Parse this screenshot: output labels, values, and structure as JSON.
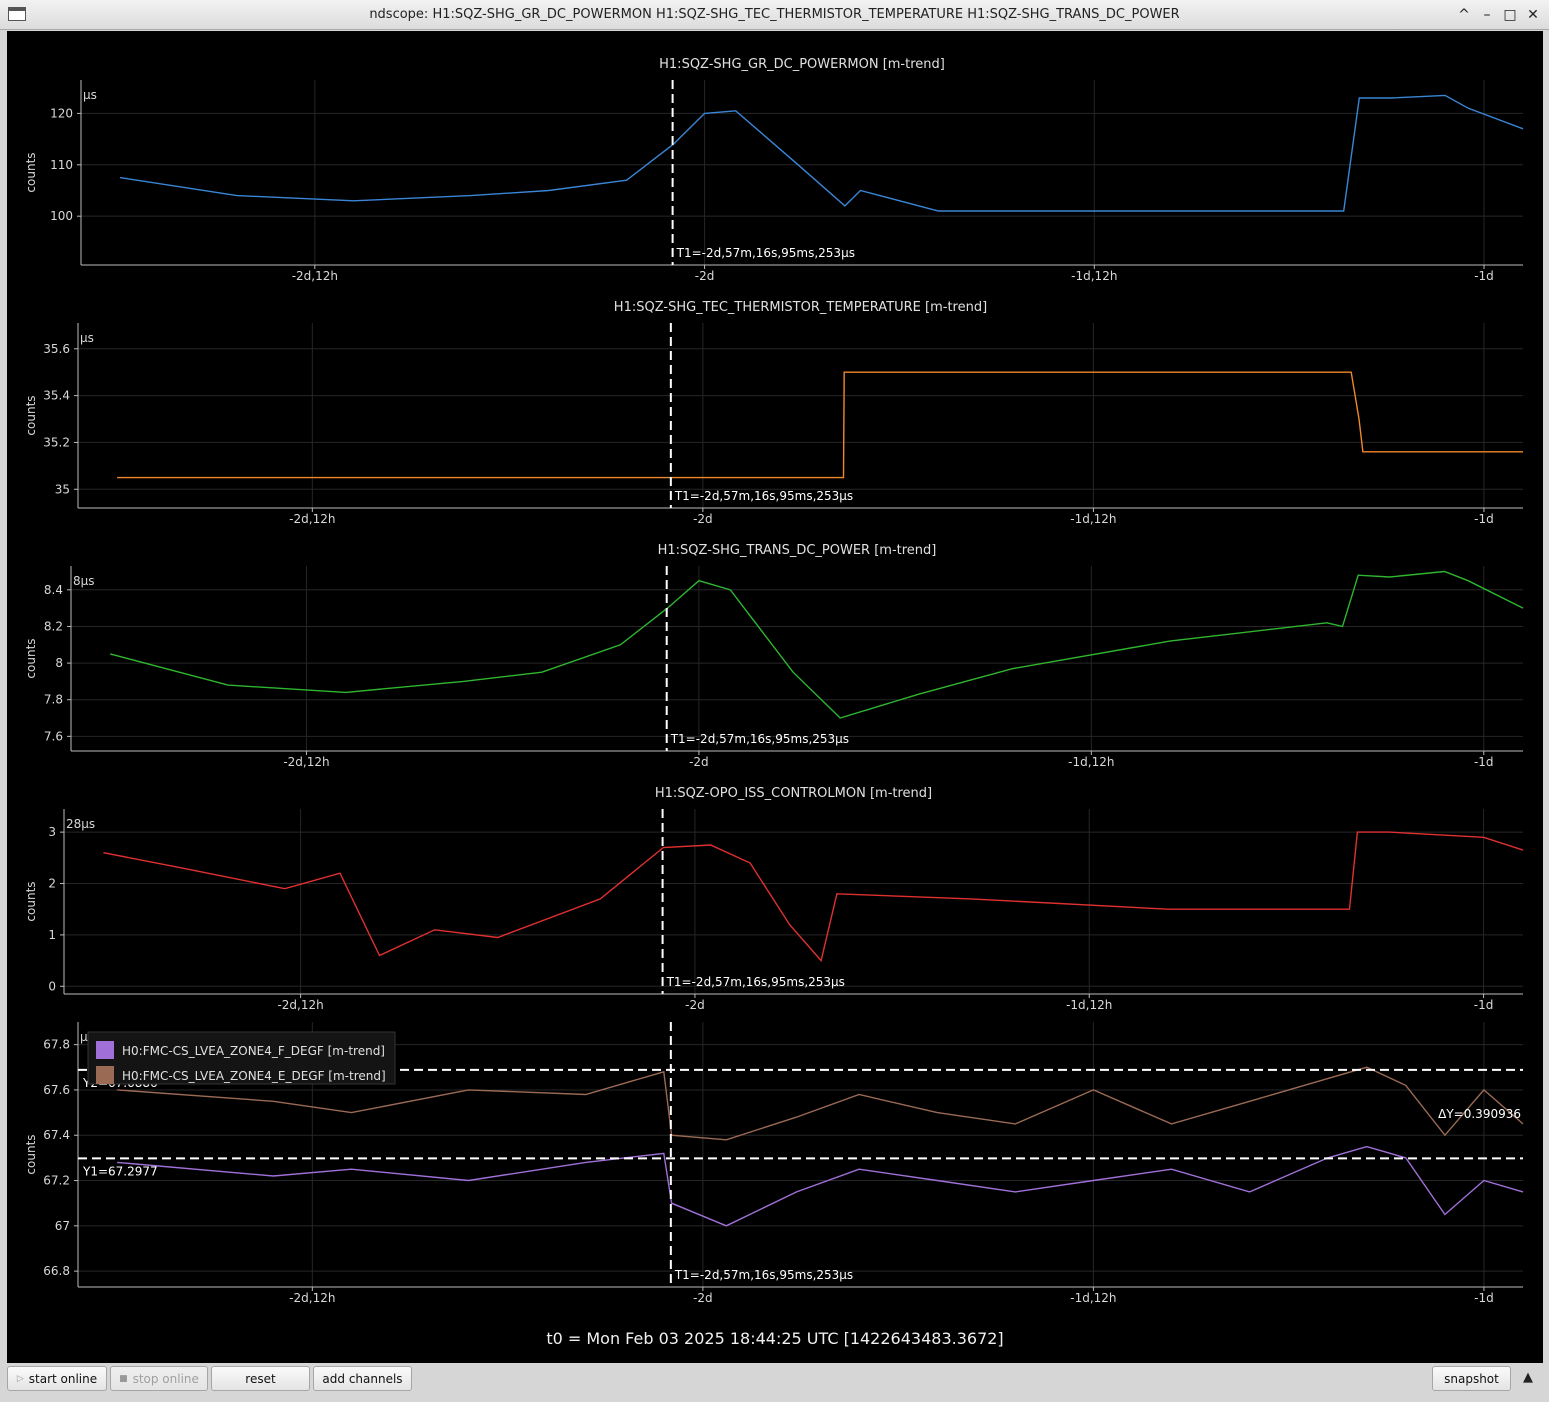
{
  "window": {
    "title": "ndscope: H1:SQZ-SHG_GR_DC_POWERMON H1:SQZ-SHG_TEC_THERMISTOR_TEMPERATURE H1:SQZ-SHG_TRANS_DC_POWER",
    "minimize": "–",
    "maximize": "□",
    "close": "✕",
    "shade": "^"
  },
  "cursor_label": "T1=-2d,57m,16s,95ms,253µs",
  "x_ticks": [
    "-2d,12h",
    "-2d",
    "-1d,12h",
    "-1d"
  ],
  "t0_label": "t0 = Mon Feb 03 2025 18:44:25 UTC [1422643483.3672]",
  "colors": {
    "background": "#000000",
    "blue": "#3a86d6",
    "orange": "#f0872a",
    "green": "#2fb52f",
    "red": "#e03030",
    "purple": "#a070d8",
    "brown": "#9a6a55",
    "cursor": "#ffffff"
  },
  "chart_data": [
    {
      "type": "line",
      "title": "H1:SQZ-SHG_GR_DC_POWERMON [m-trend]",
      "ylabel": "counts",
      "corner_label": "µs",
      "y_ticks": [
        "100",
        "110",
        "120"
      ],
      "ylim": [
        90.5,
        126.5
      ],
      "x": [
        -2.75,
        -2.6,
        -2.45,
        -2.3,
        -2.2,
        -2.1,
        -2.04,
        -2.0,
        -1.96,
        -1.88,
        -1.82,
        -1.8,
        -1.7,
        -1.5,
        -1.3,
        -1.18,
        -1.16,
        -1.12,
        -1.05,
        -1.02,
        -0.95
      ],
      "series": [
        {
          "name": "",
          "values": [
            107.5,
            104,
            103,
            104,
            105,
            107,
            114,
            120,
            120.5,
            110,
            102,
            105,
            101,
            101,
            101,
            101,
            123,
            123,
            123.5,
            121,
            117
          ]
        }
      ],
      "cursor_x": -2.041
    },
    {
      "type": "line",
      "title": "H1:SQZ-SHG_TEC_THERMISTOR_TEMPERATURE [m-trend]",
      "ylabel": "counts",
      "corner_label": "µs",
      "y_ticks": [
        "35",
        "35.2",
        "35.4",
        "35.6"
      ],
      "ylim": [
        34.92,
        35.71
      ],
      "x": [
        -2.75,
        -1.82,
        -1.819,
        -1.17,
        -1.16,
        -1.155,
        -0.95
      ],
      "series": [
        {
          "name": "",
          "values": [
            35.05,
            35.05,
            35.5,
            35.5,
            35.3,
            35.16,
            35.16
          ]
        }
      ],
      "cursor_x": -2.041
    },
    {
      "type": "line",
      "title": "H1:SQZ-SHG_TRANS_DC_POWER [m-trend]",
      "ylabel": "counts",
      "corner_label": "8µs",
      "y_ticks": [
        "7.6",
        "7.8",
        "8",
        "8.2",
        "8.4"
      ],
      "ylim": [
        7.52,
        8.53
      ],
      "x": [
        -2.75,
        -2.6,
        -2.45,
        -2.3,
        -2.2,
        -2.1,
        -2.04,
        -2.0,
        -1.96,
        -1.88,
        -1.82,
        -1.72,
        -1.6,
        -1.4,
        -1.2,
        -1.18,
        -1.16,
        -1.12,
        -1.05,
        -1.02,
        -0.95
      ],
      "series": [
        {
          "name": "",
          "values": [
            8.05,
            7.88,
            7.84,
            7.9,
            7.95,
            8.1,
            8.3,
            8.45,
            8.4,
            7.95,
            7.7,
            7.83,
            7.97,
            8.12,
            8.22,
            8.2,
            8.48,
            8.47,
            8.5,
            8.45,
            8.3
          ]
        }
      ],
      "cursor_x": -2.041
    },
    {
      "type": "line",
      "title": "H1:SQZ-OPO_ISS_CONTROLMON [m-trend]",
      "ylabel": "counts",
      "corner_label": "28µs",
      "y_ticks": [
        "0",
        "1",
        "2",
        "3"
      ],
      "ylim": [
        -0.15,
        3.45
      ],
      "x": [
        -2.75,
        -2.65,
        -2.52,
        -2.45,
        -2.4,
        -2.33,
        -2.25,
        -2.12,
        -2.04,
        -1.98,
        -1.93,
        -1.88,
        -1.84,
        -1.82,
        -1.65,
        -1.4,
        -1.25,
        -1.17,
        -1.16,
        -1.12,
        -1.0,
        -0.95
      ],
      "series": [
        {
          "name": "",
          "values": [
            2.6,
            2.3,
            1.9,
            2.2,
            0.6,
            1.1,
            0.95,
            1.7,
            2.7,
            2.75,
            2.4,
            1.2,
            0.5,
            1.8,
            1.7,
            1.5,
            1.5,
            1.5,
            3.0,
            3.0,
            2.9,
            2.65
          ]
        }
      ],
      "cursor_x": -2.041
    },
    {
      "type": "line",
      "title": "",
      "ylabel": "counts",
      "corner_label": "µs",
      "y_ticks": [
        "66.8",
        "67",
        "67.2",
        "67.4",
        "67.6",
        "67.8"
      ],
      "ylim": [
        66.73,
        67.9
      ],
      "x": [
        -2.75,
        -2.55,
        -2.45,
        -2.3,
        -2.15,
        -2.05,
        -2.04,
        -1.97,
        -1.88,
        -1.8,
        -1.7,
        -1.6,
        -1.5,
        -1.4,
        -1.3,
        -1.2,
        -1.15,
        -1.1,
        -1.05,
        -1.0,
        -0.95
      ],
      "series": [
        {
          "name": "H0:FMC-CS_LVEA_ZONE4_F_DEGF [m-trend]",
          "values": [
            67.28,
            67.22,
            67.25,
            67.2,
            67.28,
            67.32,
            67.1,
            67.0,
            67.15,
            67.25,
            67.2,
            67.15,
            67.2,
            67.25,
            67.15,
            67.3,
            67.35,
            67.3,
            67.05,
            67.2,
            67.15
          ]
        },
        {
          "name": "H0:FMC-CS_LVEA_ZONE4_E_DEGF [m-trend]",
          "values": [
            67.6,
            67.55,
            67.5,
            67.6,
            67.58,
            67.68,
            67.4,
            67.38,
            67.48,
            67.58,
            67.5,
            67.45,
            67.6,
            67.45,
            67.55,
            67.65,
            67.7,
            67.62,
            67.4,
            67.6,
            67.45
          ]
        }
      ],
      "cursor_x": -2.041,
      "y_cursors": [
        {
          "label": "Y1=67.2977",
          "value": 67.2977
        },
        {
          "label": "Y2=67.6886",
          "value": 67.6886
        }
      ],
      "delta_label": "ΔY=0.390936"
    }
  ],
  "toolbar": {
    "start_online": "start online",
    "stop_online": "stop online",
    "reset": "reset",
    "add_channels": "add channels",
    "snapshot": "snapshot",
    "collapse": "▲"
  }
}
